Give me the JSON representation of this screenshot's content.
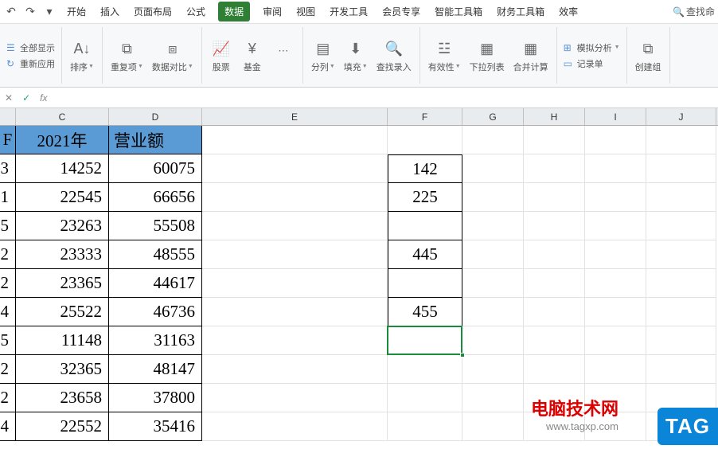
{
  "tabs": {
    "start": "开始",
    "insert": "插入",
    "layout": "页面布局",
    "formula": "公式",
    "data": "数据",
    "review": "审阅",
    "view": "视图",
    "dev": "开发工具",
    "member": "会员专享",
    "toolbox": "智能工具箱",
    "finance": "财务工具箱",
    "efficiency": "效率"
  },
  "search": {
    "label": "查找命"
  },
  "qat": {
    "show_all": "全部显示",
    "reapply": "重新应用",
    "sort": "排序"
  },
  "ribbon": {
    "dup": "重复项",
    "compare": "数据对比",
    "stock": "股票",
    "fund": "基金",
    "split": "分列",
    "fill": "填充",
    "lookup": "查找录入",
    "validity": "有效性",
    "dropdown": "下拉列表",
    "consolidate": "合并计算",
    "simulate": "模拟分析",
    "record": "记录单",
    "group": "创建组"
  },
  "formula": {
    "fx": "fx"
  },
  "columns": {
    "B": "",
    "C": "C",
    "D": "D",
    "E": "E",
    "F": "F",
    "G": "G",
    "H": "H",
    "I": "I",
    "J": "J"
  },
  "header_row": {
    "C": "2021年",
    "D": "营业额"
  },
  "col_b_frag": {
    "r2": "3",
    "r3": "1",
    "r4": "5",
    "r5": "2",
    "r6": "2",
    "r7": "4",
    "r8": "5",
    "r9": "2",
    "r10": "2",
    "r11": "4"
  },
  "sheet": {
    "C": [
      "14252",
      "22545",
      "23263",
      "23333",
      "23365",
      "25522",
      "11148",
      "32365",
      "23658",
      "22552"
    ],
    "D": [
      "60075",
      "66656",
      "55508",
      "48555",
      "44617",
      "46736",
      "31163",
      "48147",
      "37800",
      "35416"
    ],
    "F": [
      "142",
      "225",
      "",
      "445",
      "",
      "455"
    ]
  },
  "chart_data": {
    "type": "table",
    "columns": [
      "2021年",
      "营业额"
    ],
    "rows": [
      [
        14252,
        60075
      ],
      [
        22545,
        66656
      ],
      [
        23263,
        55508
      ],
      [
        23333,
        48555
      ],
      [
        23365,
        44617
      ],
      [
        25522,
        46736
      ],
      [
        11148,
        31163
      ],
      [
        32365,
        48147
      ],
      [
        23658,
        37800
      ],
      [
        22552,
        35416
      ]
    ],
    "aux_column_F": [
      142,
      225,
      null,
      445,
      null,
      455
    ]
  },
  "watermark": {
    "site": "电脑技术网",
    "url": "www.tagxp.com",
    "tag": "TAG"
  }
}
